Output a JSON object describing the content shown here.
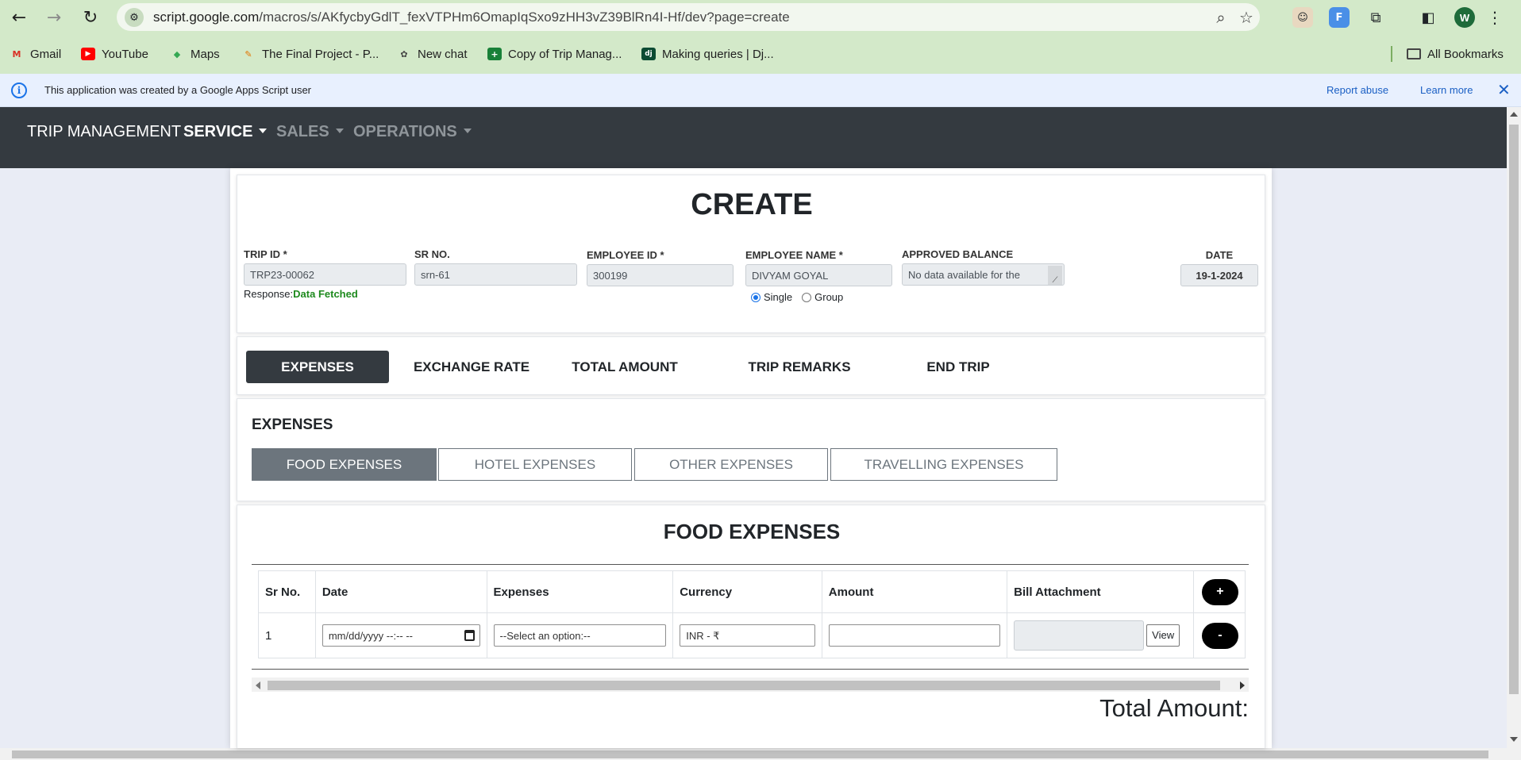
{
  "browser": {
    "url_host": "script.google.com",
    "url_path": "/macros/s/AKfycbyGdlT_fexVTPHm6OmapIqSxo9zHH3vZ39BlRn4I-Hf/dev?page=create",
    "avatar_letter": "W",
    "bookmarks": [
      {
        "label": "Gmail",
        "icon": "gmail-icon",
        "glyph": "M",
        "color": "#d93025"
      },
      {
        "label": "YouTube",
        "icon": "youtube-icon",
        "glyph": "▶",
        "color": "#ff0000"
      },
      {
        "label": "Maps",
        "icon": "maps-icon",
        "glyph": "◆",
        "color": "#34a853"
      },
      {
        "label": "The Final Project - P...",
        "icon": "project-icon",
        "glyph": "✎",
        "color": "#e37400"
      },
      {
        "label": "New chat",
        "icon": "chat-icon",
        "glyph": "✿",
        "color": "#444444"
      },
      {
        "label": "Copy of Trip Manag...",
        "icon": "sheets-icon",
        "glyph": "+",
        "color": "#188038"
      },
      {
        "label": "Making queries | Dj...",
        "icon": "django-icon",
        "glyph": "dj",
        "color": "#0c4b33"
      }
    ],
    "all_bookmarks": "All Bookmarks"
  },
  "banner": {
    "message": "This application was created by a Google Apps Script user",
    "report": "Report abuse",
    "learn": "Learn more"
  },
  "navbar": {
    "brand": "TRIP MANAGEMENT",
    "items": [
      {
        "label": "SERVICE",
        "active": true
      },
      {
        "label": "SALES",
        "active": false
      },
      {
        "label": "OPERATIONS",
        "active": false
      }
    ]
  },
  "form": {
    "title": "CREATE",
    "trip_id_label": "TRIP ID *",
    "trip_id": "TRP23-00062",
    "sr_no_label": "SR NO.",
    "sr_no": "srn-61",
    "employee_id_label": "EMPLOYEE ID *",
    "employee_id": "300199",
    "employee_name_label": "EMPLOYEE NAME *",
    "employee_name": "DIVYAM GOYAL",
    "approved_balance_label": "APPROVED BALANCE",
    "approved_balance": "No data available for the",
    "date_label": "DATE",
    "date": "19-1-2024",
    "response_label": "Response:",
    "response_value": "Data Fetched",
    "radio_single": "Single",
    "radio_group": "Group"
  },
  "main_tabs": [
    "EXPENSES",
    "EXCHANGE RATE",
    "TOTAL AMOUNT",
    "TRIP REMARKS",
    "END TRIP"
  ],
  "expenses": {
    "heading": "EXPENSES",
    "sub_tabs": [
      "FOOD EXPENSES",
      "HOTEL EXPENSES",
      "OTHER EXPENSES",
      "TRAVELLING EXPENSES"
    ]
  },
  "food": {
    "title": "FOOD EXPENSES",
    "columns": [
      "Sr No.",
      "Date",
      "Expenses",
      "Currency",
      "Amount",
      "Bill Attachment"
    ],
    "add_label": "+",
    "remove_label": "-",
    "row": {
      "sr": "1",
      "date_placeholder": "mm/dd/yyyy --:-- --",
      "expense_placeholder": "--Select an option:--",
      "currency": "INR - ₹",
      "amount": "",
      "view": "View"
    },
    "total_label": "Total Amount:"
  }
}
